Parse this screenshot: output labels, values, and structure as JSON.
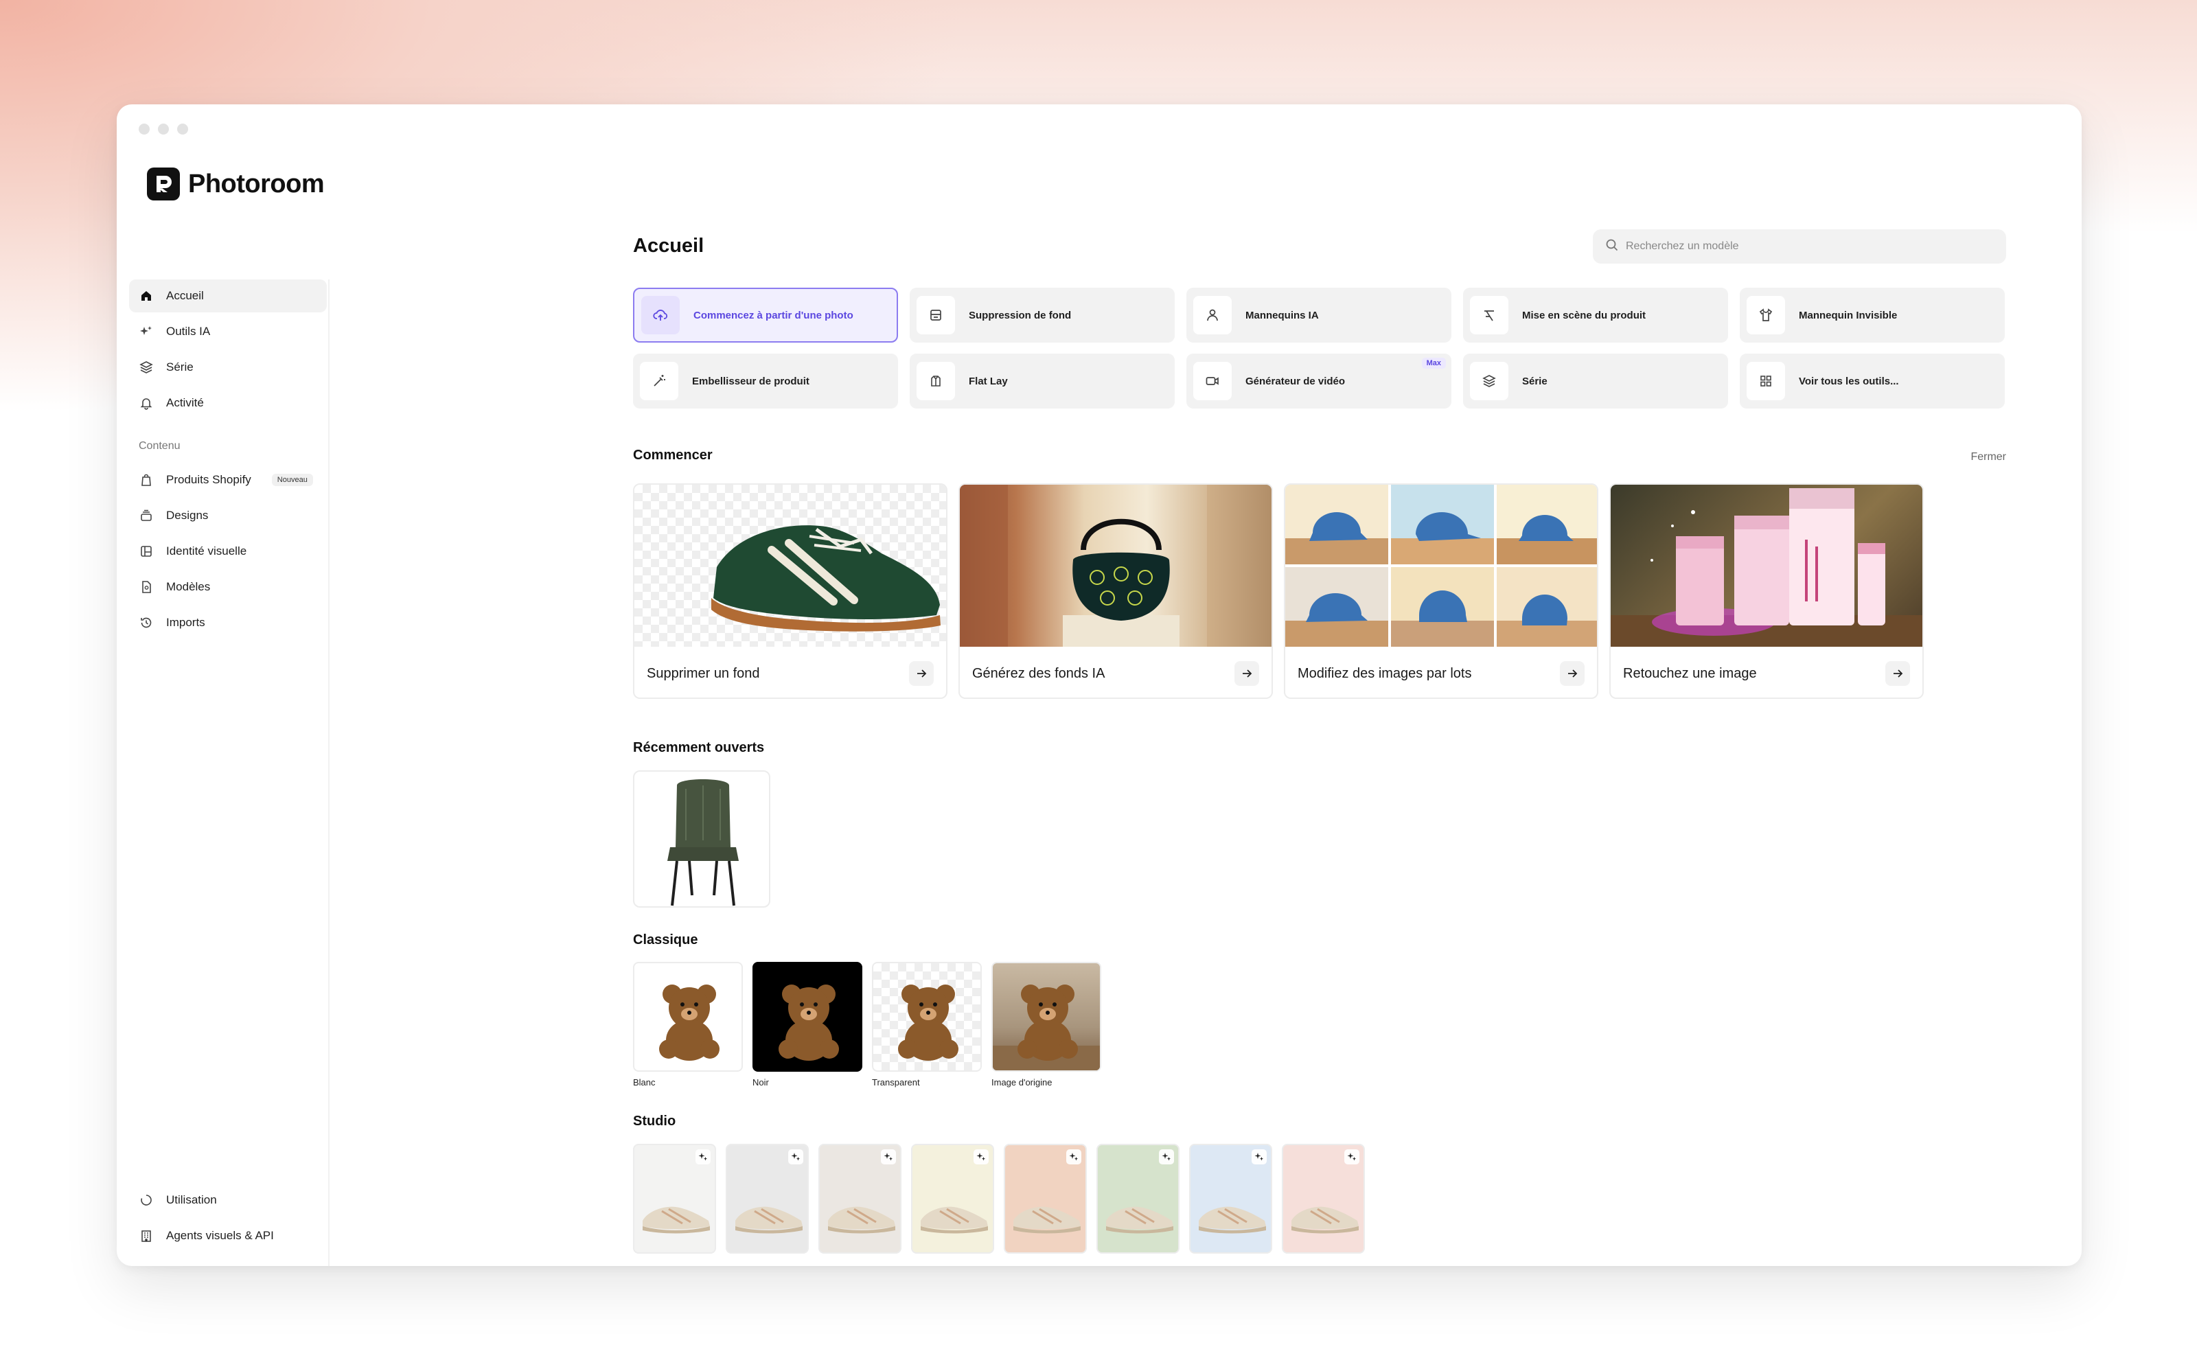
{
  "app": {
    "name": "Photoroom"
  },
  "sidebar": {
    "nav": [
      {
        "label": "Accueil",
        "icon": "home-icon",
        "active": true
      },
      {
        "label": "Outils IA",
        "icon": "sparkles-icon"
      },
      {
        "label": "Série",
        "icon": "layers-icon"
      },
      {
        "label": "Activité",
        "icon": "bell-icon"
      }
    ],
    "content_label": "Contenu",
    "content": [
      {
        "label": "Produits Shopify",
        "icon": "shopify-icon",
        "badge": "Nouveau"
      },
      {
        "label": "Designs",
        "icon": "designs-icon"
      },
      {
        "label": "Identité visuelle",
        "icon": "brand-kit-icon"
      },
      {
        "label": "Modèles",
        "icon": "templates-icon"
      },
      {
        "label": "Imports",
        "icon": "history-icon"
      }
    ],
    "bottom": [
      {
        "label": "Utilisation",
        "icon": "usage-icon"
      },
      {
        "label": "Agents visuels & API",
        "icon": "building-icon"
      }
    ]
  },
  "main": {
    "title": "Accueil",
    "search_placeholder": "Recherchez un modèle",
    "tools": [
      {
        "label": "Commencez à partir d'une photo",
        "icon": "upload-cloud-icon"
      },
      {
        "label": "Suppression de fond",
        "icon": "remove-bg-icon"
      },
      {
        "label": "Mannequins IA",
        "icon": "person-icon"
      },
      {
        "label": "Mise en scène du produit",
        "icon": "staging-icon"
      },
      {
        "label": "Mannequin Invisible",
        "icon": "shirt-icon"
      },
      {
        "label": "Embellisseur de produit",
        "icon": "magic-wand-icon"
      },
      {
        "label": "Flat Lay",
        "icon": "flat-lay-icon"
      },
      {
        "label": "Générateur de vidéo",
        "icon": "video-icon",
        "badge": "Max"
      },
      {
        "label": "Série",
        "icon": "layers-icon"
      },
      {
        "label": "Voir tous les outils...",
        "icon": "grid-icon"
      }
    ],
    "start": {
      "title": "Commencer",
      "close": "Fermer",
      "cards": [
        {
          "label": "Supprimer un fond"
        },
        {
          "label": "Générez des fonds IA"
        },
        {
          "label": "Modifiez des images par lots"
        },
        {
          "label": "Retouchez une image"
        }
      ]
    },
    "recent": {
      "title": "Récemment ouverts"
    },
    "classic": {
      "title": "Classique",
      "items": [
        {
          "label": "Blanc",
          "bg": "#ffffff"
        },
        {
          "label": "Noir",
          "bg": "#000000"
        },
        {
          "label": "Transparent",
          "bg": "transparent"
        },
        {
          "label": "Image d'origine",
          "bg": "original"
        }
      ]
    },
    "studio": {
      "title": "Studio",
      "backgrounds": [
        "#f3f3f2",
        "#e9e9e9",
        "#ebe7e2",
        "#f4f1dd",
        "#f1d3c1",
        "#d6e3cc",
        "#dde8f4",
        "#f6dfda"
      ]
    }
  },
  "colors": {
    "accent": "#5b47e0",
    "accent_bg": "#f1effe"
  }
}
